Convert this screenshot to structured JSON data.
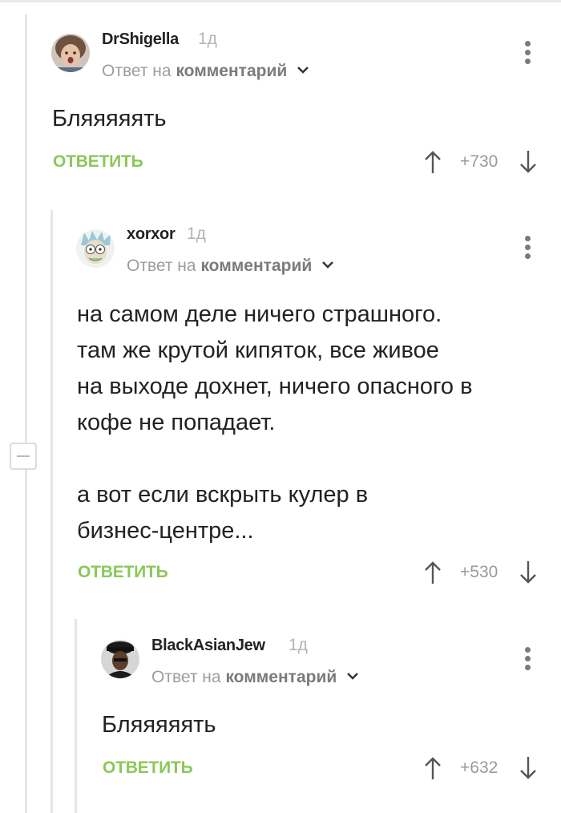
{
  "comments": [
    {
      "username": "DrShigella",
      "time": "1д",
      "reply_prefix": "Ответ на",
      "reply_target": "комментарий",
      "lines": [
        "Бляяяяять"
      ],
      "reply_label": "ОТВЕТИТЬ",
      "rating": "+730"
    },
    {
      "username": "xorxor",
      "time": "1д",
      "reply_prefix": "Ответ на",
      "reply_target": "комментарий",
      "lines": [
        "на самом деле ничего страшного.",
        "там же крутой кипяток, все живое",
        "на выходе дохнет, ничего опасного в",
        "кофе не попадает.",
        "",
        "а вот если вскрыть кулер в",
        "бизнес-центре..."
      ],
      "reply_label": "ОТВЕТИТЬ",
      "rating": "+530"
    },
    {
      "username": "BlackAsianJew",
      "time": "1д",
      "reply_prefix": "Ответ на",
      "reply_target": "комментарий",
      "lines": [
        "Бляяяяять"
      ],
      "reply_label": "ОТВЕТИТЬ",
      "rating": "+632"
    }
  ],
  "icons": {
    "menu": "more-vertical-icon",
    "up": "arrow-up-icon",
    "down": "arrow-down-icon",
    "collapse": "minus-icon",
    "chevron": "chevron-down-icon"
  },
  "colors": {
    "reply_button": "#8ac858",
    "rating": "#9a9a9a",
    "thread_line": "#e6e6e6"
  }
}
